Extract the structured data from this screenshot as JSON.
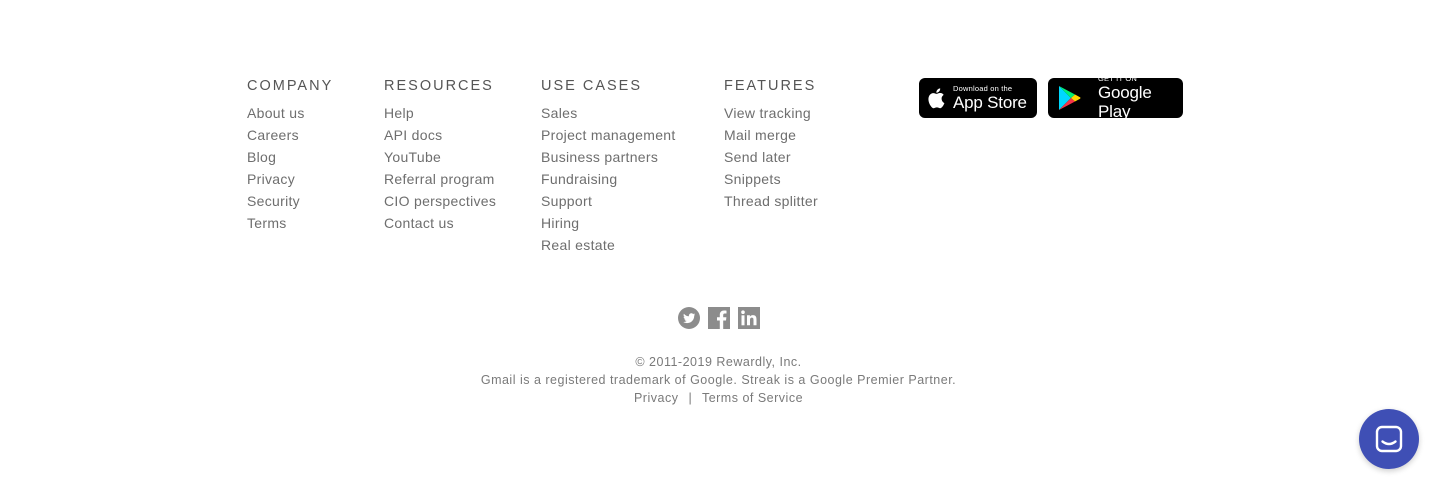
{
  "footer": {
    "columns": [
      {
        "heading": "COMPANY",
        "links": [
          "About us",
          "Careers",
          "Blog",
          "Privacy",
          "Security",
          "Terms"
        ]
      },
      {
        "heading": "RESOURCES",
        "links": [
          "Help",
          "API docs",
          "YouTube",
          "Referral program",
          "CIO perspectives",
          "Contact us"
        ]
      },
      {
        "heading": "USE CASES",
        "links": [
          "Sales",
          "Project management",
          "Business partners",
          "Fundraising",
          "Support",
          "Hiring",
          "Real estate"
        ]
      },
      {
        "heading": "FEATURES",
        "links": [
          "View tracking",
          "Mail merge",
          "Send later",
          "Snippets",
          "Thread splitter"
        ]
      }
    ],
    "app_store": {
      "small": "Download on the",
      "big": "App Store"
    },
    "google_play": {
      "small": "GET IT ON",
      "big": "Google Play"
    },
    "social": [
      "twitter-icon",
      "facebook-icon",
      "linkedin-icon"
    ],
    "copyright": "© 2011-2019 Rewardly, Inc.",
    "trademark": "Gmail is a registered trademark of Google. Streak is a Google Premier Partner.",
    "legal_links": {
      "privacy": "Privacy",
      "separator": "|",
      "terms": "Terms of Service"
    }
  },
  "colors": {
    "chat_button": "#3f4fb5",
    "badge": "#000000",
    "social_icon": "#888888"
  }
}
